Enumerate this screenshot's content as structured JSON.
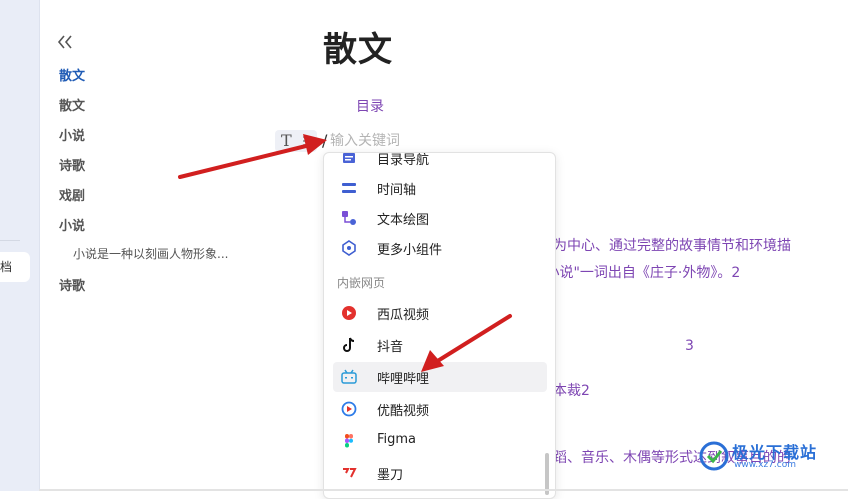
{
  "sidebar_strip": {
    "selected_label": "档"
  },
  "outline": {
    "items": [
      {
        "label": "散文",
        "active": true
      },
      {
        "label": "散文"
      },
      {
        "label": "小说"
      },
      {
        "label": "诗歌"
      },
      {
        "label": "戏剧"
      },
      {
        "label": "小说"
      },
      {
        "label": "小说是一种以刻画人物形象...",
        "sub": true
      },
      {
        "label": "诗歌"
      }
    ]
  },
  "document": {
    "title": "散文",
    "toc_label": "目录",
    "body_fragments": [
      "为中心、通过完整的故事情节和环境描",
      "\"小说\"一词出自《庄子·外物》。2",
      "3",
      "本裁2",
      "蹈、音乐、木偶等形式达到叙事目的的"
    ]
  },
  "insert_bar": {
    "block_icon_letter": "T",
    "slash": "/",
    "input_placeholder": "输入关键词",
    "input_value": ""
  },
  "dropdown": {
    "items_top": [
      {
        "label": "目录导航",
        "icon": "toc-nav-icon"
      },
      {
        "label": "时间轴",
        "icon": "timeline-icon"
      },
      {
        "label": "文本绘图",
        "icon": "text-drawing-icon"
      },
      {
        "label": "更多小组件",
        "icon": "widgets-icon"
      }
    ],
    "section_label": "内嵌网页",
    "items_embed": [
      {
        "label": "西瓜视频",
        "icon": "xigua-video-icon"
      },
      {
        "label": "抖音",
        "icon": "douyin-icon"
      },
      {
        "label": "哔哩哔哩",
        "icon": "bilibili-icon",
        "hover": true
      },
      {
        "label": "优酷视频",
        "icon": "youku-icon"
      },
      {
        "label": "Figma",
        "icon": "figma-icon"
      },
      {
        "label": "墨刀",
        "icon": "modao-icon"
      }
    ]
  },
  "watermark": {
    "text": "极光下载站",
    "url": "www.xz7.com"
  },
  "colors": {
    "accent_blue": "#1f5bb5",
    "link_purple": "#7e46b3",
    "annotation_red": "#d11f1f"
  }
}
